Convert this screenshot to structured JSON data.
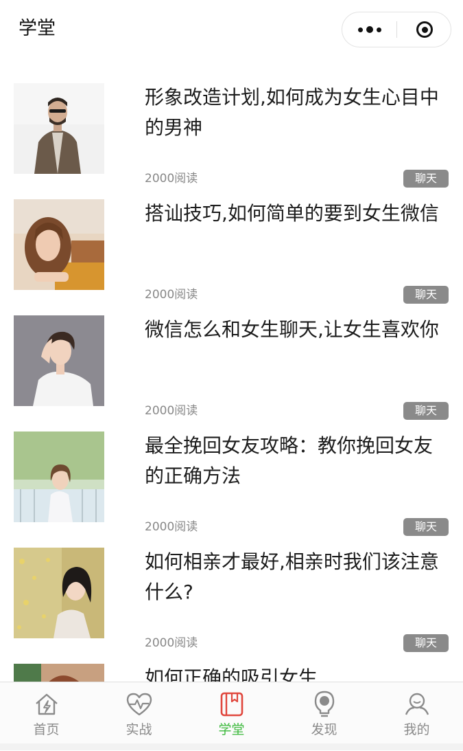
{
  "header": {
    "title": "学堂",
    "more_icon": "more-dots-icon",
    "close_icon": "target-close-icon"
  },
  "articles": [
    {
      "title": "形象改造计划,如何成为女生心目中的男神",
      "reads": "2000阅读",
      "tag": "聊天",
      "image": "man-in-suit-photo"
    },
    {
      "title": "搭讪技巧,如何简单的要到女生微信",
      "reads": "2000阅读",
      "tag": "聊天",
      "image": "woman-lying-photo"
    },
    {
      "title": "微信怎么和女生聊天,让女生喜欢你",
      "reads": "2000阅读",
      "tag": "聊天",
      "image": "woman-white-shirt-photo"
    },
    {
      "title": "最全挽回女友攻略：教你挽回女友的正确方法",
      "reads": "2000阅读",
      "tag": "聊天",
      "image": "woman-outdoor-photo"
    },
    {
      "title": "如何相亲才最好,相亲时我们该注意什么?",
      "reads": "2000阅读",
      "tag": "聊天",
      "image": "woman-flowers-photo"
    },
    {
      "title": "如何正确的吸引女生",
      "reads": "",
      "tag": "",
      "image": "woman-photo"
    }
  ],
  "tabbar": {
    "active_color": "#3cb93c",
    "inactive_color": "#8a8a8a",
    "items": [
      {
        "label": "首页",
        "icon": "home-icon"
      },
      {
        "label": "实战",
        "icon": "heartbeat-icon"
      },
      {
        "label": "学堂",
        "icon": "book-icon",
        "active": true
      },
      {
        "label": "发现",
        "icon": "lightbulb-icon"
      },
      {
        "label": "我的",
        "icon": "profile-icon"
      }
    ]
  }
}
